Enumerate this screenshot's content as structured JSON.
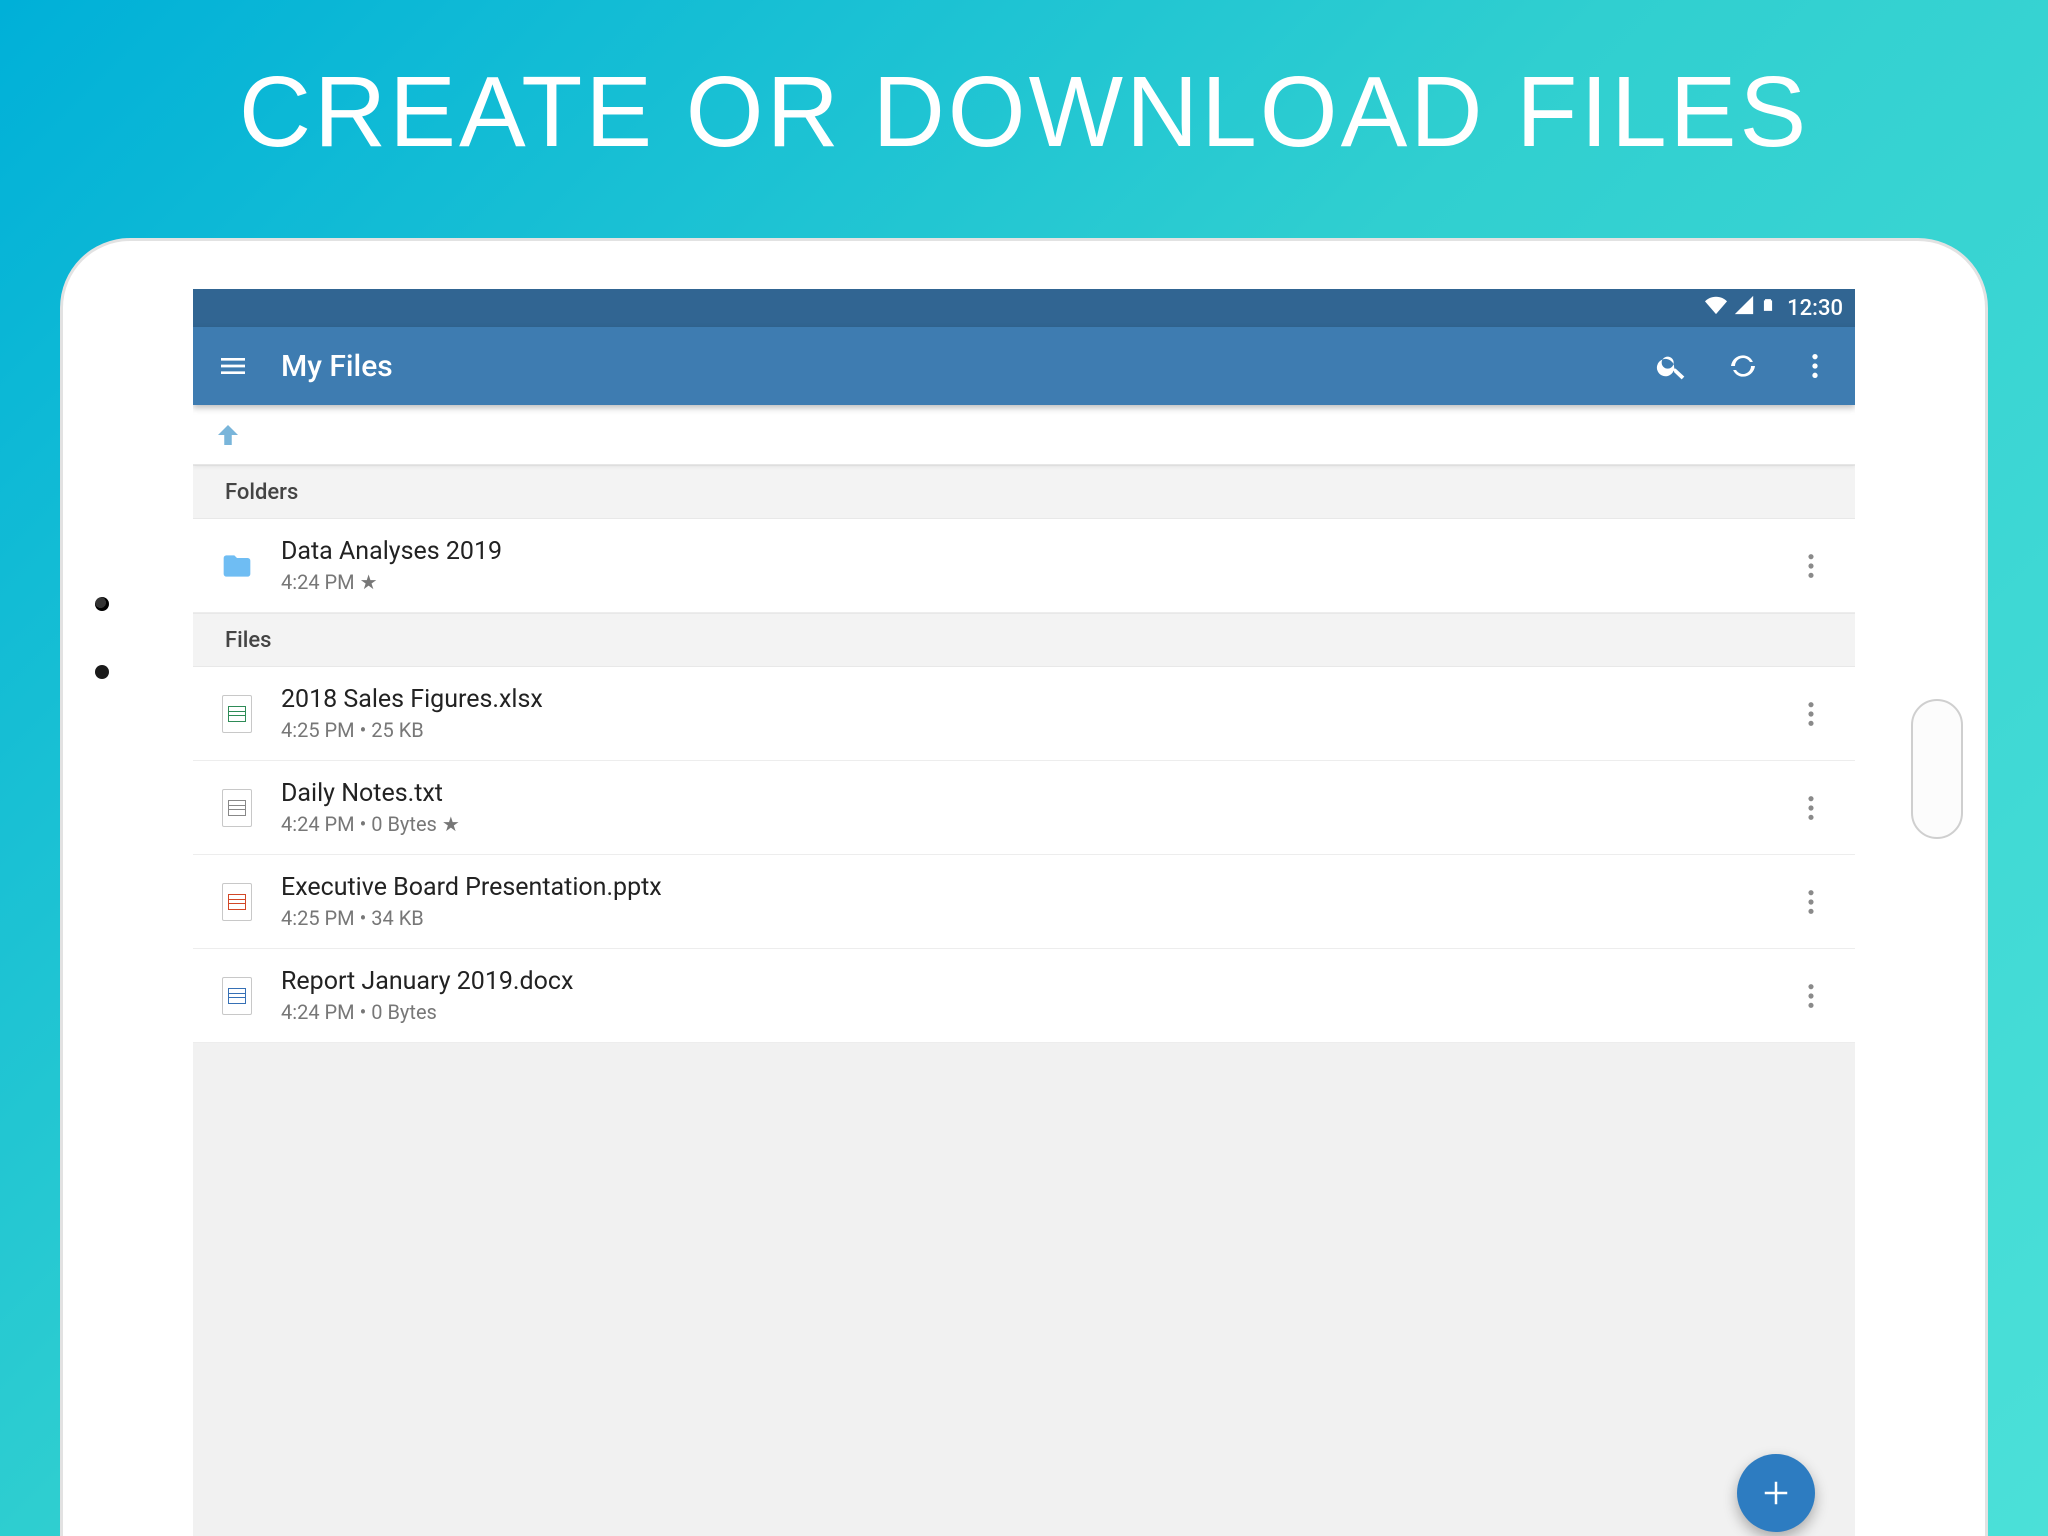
{
  "headline": "CREATE OR DOWNLOAD FILES",
  "status": {
    "time": "12:30"
  },
  "appbar": {
    "title": "My Files"
  },
  "sections": {
    "folders": "Folders",
    "files": "Files"
  },
  "folders": [
    {
      "name": "Data Analyses 2019",
      "sub": "4:24 PM ★"
    }
  ],
  "files": [
    {
      "name": "2018 Sales Figures.xlsx",
      "sub": "4:25 PM  •  25 KB",
      "type": "xlsx"
    },
    {
      "name": "Daily Notes.txt",
      "sub": "4:24 PM  •  0 Bytes ★",
      "type": "txt"
    },
    {
      "name": "Executive Board Presentation.pptx",
      "sub": "4:25 PM  •  34 KB",
      "type": "pptx"
    },
    {
      "name": "Report January 2019.docx",
      "sub": "4:24 PM  •  0 Bytes",
      "type": "docx"
    }
  ]
}
